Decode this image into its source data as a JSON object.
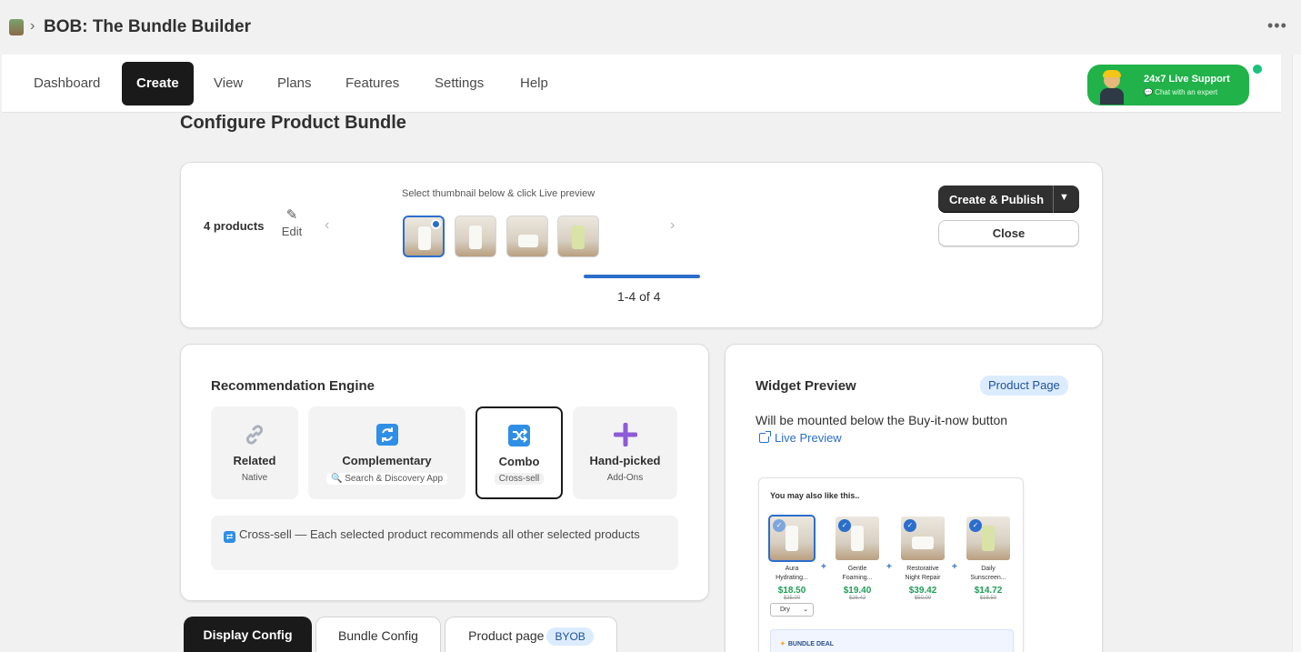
{
  "header": {
    "app_title": "BOB: The Bundle Builder",
    "more_menu": "•••"
  },
  "nav": {
    "items": [
      "Dashboard",
      "Create",
      "View",
      "Plans",
      "Features",
      "Settings",
      "Help"
    ],
    "active": "Create"
  },
  "support": {
    "title": "24x7 Live Support",
    "subtitle": "Chat with an expert"
  },
  "page": {
    "title": "Configure Product Bundle"
  },
  "bundle": {
    "products_count": "4 products",
    "edit_label": "Edit",
    "thumb_hint": "Select thumbnail below & click Live preview",
    "pager": "1-4 of 4",
    "create_publish": "Create & Publish",
    "close": "Close"
  },
  "engine": {
    "title": "Recommendation Engine",
    "options": [
      {
        "name": "Related",
        "sub": "Native",
        "icon": "link-icon"
      },
      {
        "name": "Complementary",
        "sub": "🔍 Search & Discovery App",
        "icon": "refresh-icon"
      },
      {
        "name": "Combo",
        "sub": "Cross-sell",
        "icon": "shuffle-icon"
      },
      {
        "name": "Hand-picked",
        "sub": "Add-Ons",
        "icon": "plus-icon"
      }
    ],
    "selected": "Combo",
    "note": "Cross-sell — Each selected product recommends all other selected products"
  },
  "tabs": {
    "display_config": "Display Config",
    "bundle_config": "Bundle Config",
    "product_page": "Product page",
    "byob_badge": "BYOB"
  },
  "widget_preview": {
    "title": "Widget Preview",
    "badge": "Product Page",
    "mount_text": "Will be mounted below the Buy-it-now button",
    "live_preview": "Live Preview",
    "heading": "You may also like this..",
    "items": [
      {
        "name_line1": "Aura",
        "name_line2": "Hydrating...",
        "price": "$18.50",
        "old_price": "$25.00"
      },
      {
        "name_line1": "Gentle",
        "name_line2": "Foaming...",
        "price": "$19.40",
        "old_price": "$26.42"
      },
      {
        "name_line1": "Restorative",
        "name_line2": "Night Repair",
        "price": "$39.42",
        "old_price": "$50.00"
      },
      {
        "name_line1": "Daily",
        "name_line2": "Sunscreen...",
        "price": "$14.72",
        "old_price": "$18.50"
      }
    ],
    "variant": "Dry",
    "deal": "BUNDLE DEAL"
  },
  "colors": {
    "accent": "#2c6ecb",
    "primary_dark": "#303030",
    "support_green": "#21b24a",
    "price_green": "#1f9d55"
  }
}
